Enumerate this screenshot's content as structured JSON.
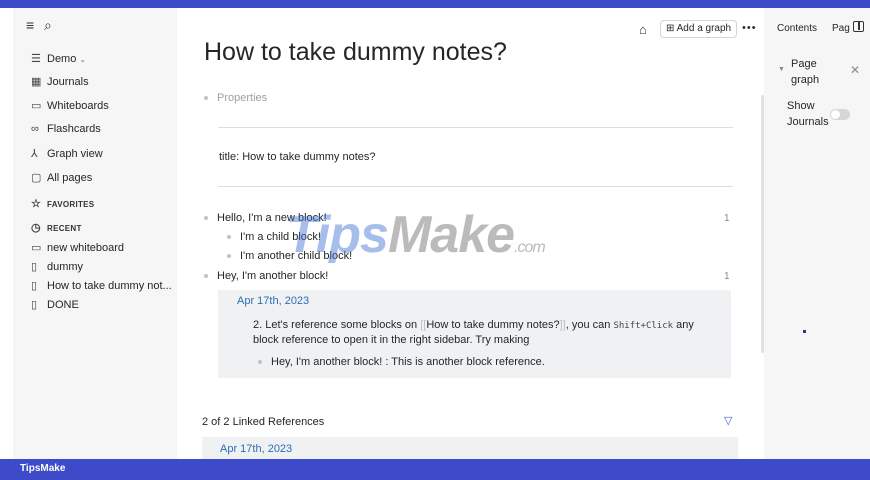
{
  "sidebar": {
    "menu_icon": "menu-icon",
    "search_icon": "search-icon",
    "graph_label": "Demo",
    "items": [
      {
        "icon": "▦",
        "label": "Journals"
      },
      {
        "icon": "▭",
        "label": "Whiteboards"
      },
      {
        "icon": "∞",
        "label": "Flashcards"
      },
      {
        "icon": "⅄",
        "label": "Graph view"
      },
      {
        "icon": "▢",
        "label": "All pages"
      }
    ],
    "favorites_label": "FAVORITES",
    "recent_label": "RECENT",
    "recent": [
      {
        "icon": "▭",
        "label": "new whiteboard"
      },
      {
        "icon": "▯",
        "label": "dummy"
      },
      {
        "icon": "▯",
        "label": "How to take dummy not..."
      },
      {
        "icon": "▯",
        "label": "DONE"
      }
    ]
  },
  "toolbar": {
    "add_graph_label": "Add a graph",
    "more_label": "•••"
  },
  "page": {
    "title": "How to take dummy notes?",
    "properties_label": "Properties",
    "title_property": "title: How to take dummy notes?",
    "blocks": [
      {
        "text": "Hello, I'm a new block!",
        "count": "1"
      },
      {
        "text": "I'm a child block!"
      },
      {
        "text": "I'm another child block!"
      },
      {
        "text": "Hey, I'm another block!",
        "count": "1"
      }
    ],
    "reference": {
      "date": "Apr 17th, 2023",
      "line1_prefix": "2. Let's reference some blocks on",
      "link": "How to take dummy notes?",
      "line1_mid": ", you can",
      "shortcut": "Shift+Click",
      "line1_suffix": "any",
      "line2": "block reference to open it in the right sidebar. Try making",
      "child": "Hey, I'm another block! : This is another block reference."
    },
    "linked_references": "2 of 2 Linked References",
    "linked_date": "Apr 17th, 2023"
  },
  "right_sidebar": {
    "tab_contents": "Contents",
    "tab_page": "Pag",
    "page_graph": [
      "Page",
      "graph"
    ],
    "show_journals": [
      "Show",
      "Journals"
    ]
  },
  "watermark": {
    "part1": "Tips",
    "part2": "Make",
    "part3": ".com"
  },
  "footer": {
    "brand": "TipsMake"
  },
  "colors": {
    "frame": "#3d4ac9",
    "link": "#2c6db4",
    "sidebar_bg": "#f6f6f7"
  }
}
